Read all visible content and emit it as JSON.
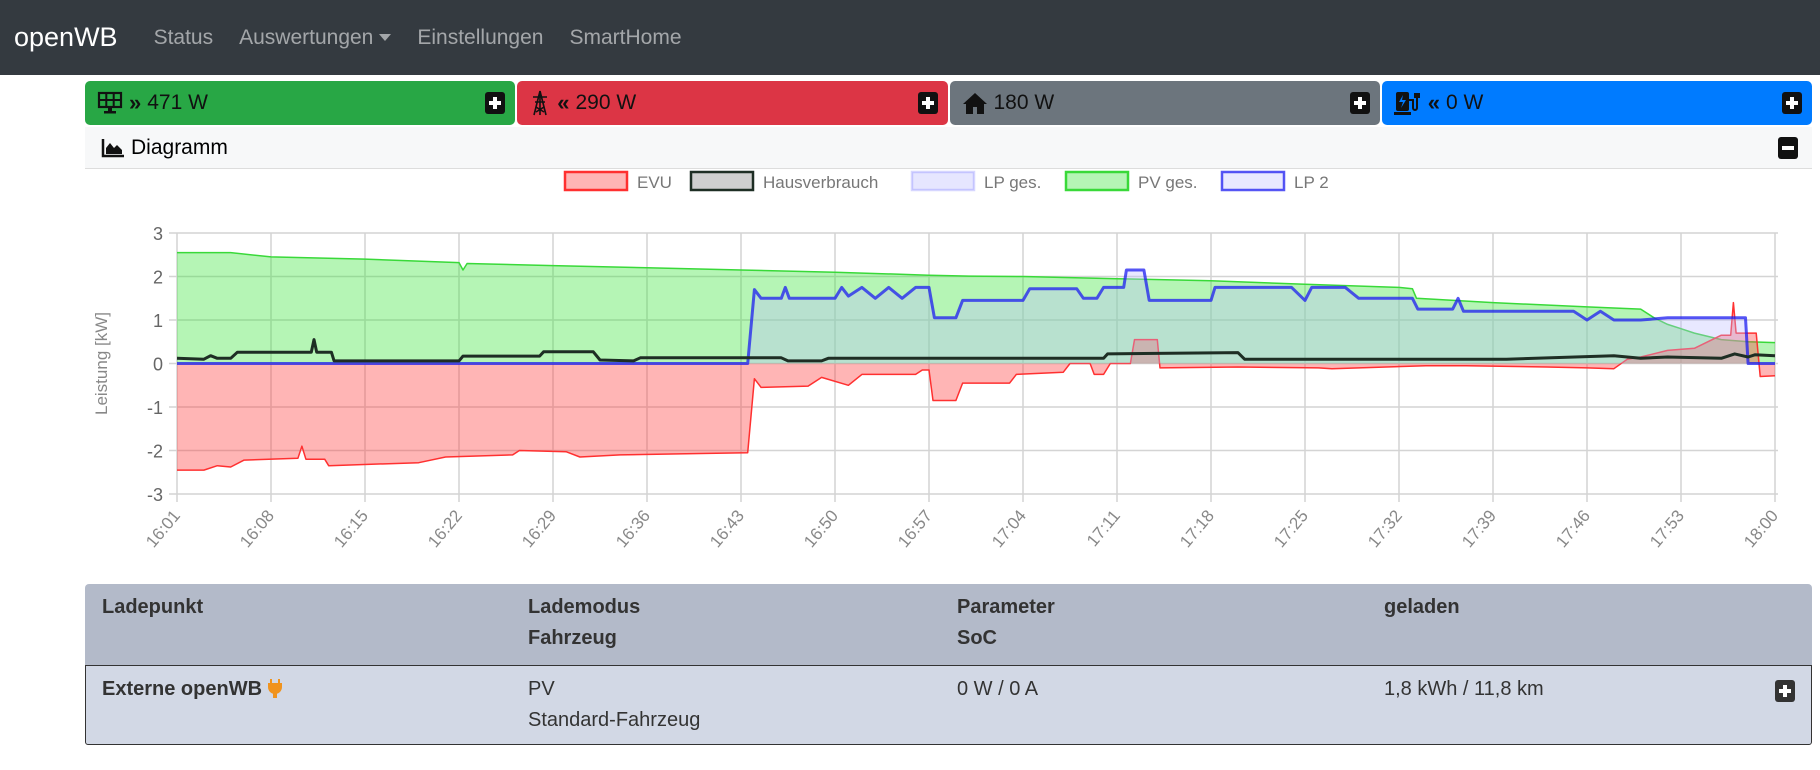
{
  "nav": {
    "brand": "openWB",
    "links": [
      "Status",
      "Auswertungen",
      "Einstellungen",
      "SmartHome"
    ]
  },
  "cards": [
    {
      "icon": "solar-panel-icon",
      "arrow": "»",
      "value": "471 W",
      "color": "#28a745"
    },
    {
      "icon": "power-tower-icon",
      "arrow": "«",
      "value": "290 W",
      "color": "#dc3545"
    },
    {
      "icon": "house-icon",
      "arrow": "",
      "value": "180 W",
      "color": "#6c757d"
    },
    {
      "icon": "charging-station-icon",
      "arrow": "«",
      "value": "0 W",
      "color": "#007bff"
    }
  ],
  "diagram": {
    "title": "Diagramm"
  },
  "chart_data": {
    "type": "line",
    "ylabel": "Leistung [kW]",
    "ylim": [
      -3,
      3
    ],
    "yticks": [
      3,
      2,
      1,
      0,
      -1,
      -2,
      -3
    ],
    "x_unit": "minutes after 16:00",
    "xticks": [
      "16:01",
      "16:08",
      "16:15",
      "16:22",
      "16:29",
      "16:36",
      "16:43",
      "16:50",
      "16:57",
      "17:04",
      "17:11",
      "17:18",
      "17:25",
      "17:32",
      "17:39",
      "17:46",
      "17:53",
      "18:00"
    ],
    "xlim": [
      1,
      120
    ],
    "legend_position": "top",
    "series": [
      {
        "name": "EVU",
        "stroke": "#ff3030",
        "fill": "rgba(255,60,60,0.38)",
        "points": [
          [
            1,
            -2.45
          ],
          [
            3,
            -2.45
          ],
          [
            4,
            -2.35
          ],
          [
            5,
            -2.38
          ],
          [
            6,
            -2.22
          ],
          [
            10,
            -2.18
          ],
          [
            10.3,
            -1.9
          ],
          [
            10.6,
            -2.2
          ],
          [
            12,
            -2.2
          ],
          [
            12.3,
            -2.35
          ],
          [
            19,
            -2.28
          ],
          [
            21,
            -2.15
          ],
          [
            26,
            -2.1
          ],
          [
            26.5,
            -2.0
          ],
          [
            30,
            -2.03
          ],
          [
            31,
            -2.15
          ],
          [
            34,
            -2.1
          ],
          [
            40,
            -2.07
          ],
          [
            43.5,
            -2.05
          ],
          [
            44,
            -0.35
          ],
          [
            44.5,
            -0.55
          ],
          [
            48,
            -0.52
          ],
          [
            49,
            -0.32
          ],
          [
            51,
            -0.5
          ],
          [
            52,
            -0.25
          ],
          [
            56,
            -0.25
          ],
          [
            56.5,
            -0.15
          ],
          [
            57,
            -0.15
          ],
          [
            57.3,
            -0.85
          ],
          [
            59,
            -0.85
          ],
          [
            59.5,
            -0.45
          ],
          [
            63,
            -0.45
          ],
          [
            63.5,
            -0.25
          ],
          [
            67,
            -0.2
          ],
          [
            67.5,
            0.0
          ],
          [
            69,
            0.0
          ],
          [
            69.3,
            -0.25
          ],
          [
            70,
            -0.25
          ],
          [
            70.5,
            0.0
          ],
          [
            72,
            0.0
          ],
          [
            72.3,
            0.55
          ],
          [
            74,
            0.55
          ],
          [
            74.2,
            -0.1
          ],
          [
            80,
            -0.08
          ],
          [
            86,
            -0.1
          ],
          [
            87,
            -0.12
          ],
          [
            94,
            -0.05
          ],
          [
            97,
            -0.05
          ],
          [
            103,
            -0.08
          ],
          [
            106,
            -0.1
          ],
          [
            108,
            -0.12
          ],
          [
            109,
            0.1
          ],
          [
            110,
            0.15
          ],
          [
            112,
            0.3
          ],
          [
            114,
            0.35
          ],
          [
            116,
            0.65
          ],
          [
            116.7,
            0.65
          ],
          [
            116.9,
            1.4
          ],
          [
            117.1,
            0.7
          ],
          [
            118.6,
            0.7
          ],
          [
            118.9,
            -0.3
          ],
          [
            120,
            -0.28
          ]
        ]
      },
      {
        "name": "Hausverbrauch",
        "stroke": "#1e2e24",
        "fill": "rgba(160,160,160,0.5)",
        "points": [
          [
            1,
            0.12
          ],
          [
            3,
            0.1
          ],
          [
            3.5,
            0.18
          ],
          [
            4,
            0.12
          ],
          [
            5,
            0.12
          ],
          [
            5.5,
            0.26
          ],
          [
            11,
            0.26
          ],
          [
            11.2,
            0.55
          ],
          [
            11.4,
            0.26
          ],
          [
            12.5,
            0.26
          ],
          [
            12.7,
            0.06
          ],
          [
            22,
            0.06
          ],
          [
            22.3,
            0.17
          ],
          [
            28,
            0.17
          ],
          [
            28.3,
            0.27
          ],
          [
            32,
            0.27
          ],
          [
            32.5,
            0.08
          ],
          [
            35,
            0.06
          ],
          [
            35.5,
            0.13
          ],
          [
            46,
            0.13
          ],
          [
            46.5,
            0.06
          ],
          [
            49,
            0.06
          ],
          [
            49.5,
            0.12
          ],
          [
            70,
            0.12
          ],
          [
            70.3,
            0.22
          ],
          [
            80,
            0.25
          ],
          [
            80.5,
            0.1
          ],
          [
            100,
            0.1
          ],
          [
            108,
            0.18
          ],
          [
            110,
            0.12
          ],
          [
            112,
            0.15
          ],
          [
            116,
            0.12
          ],
          [
            117,
            0.22
          ],
          [
            118,
            0.15
          ],
          [
            118.5,
            0.2
          ],
          [
            120,
            0.18
          ]
        ]
      },
      {
        "name": "LP ges.",
        "stroke": "rgba(120,120,255,0.3)",
        "fill": "rgba(200,200,255,0.45)",
        "points": []
      },
      {
        "name": "PV ges.",
        "stroke": "#39d939",
        "fill": "rgba(60,230,60,0.38)",
        "points": [
          [
            1,
            2.55
          ],
          [
            5,
            2.55
          ],
          [
            8,
            2.45
          ],
          [
            15,
            2.4
          ],
          [
            22,
            2.32
          ],
          [
            22.3,
            2.15
          ],
          [
            22.6,
            2.3
          ],
          [
            29,
            2.25
          ],
          [
            36,
            2.2
          ],
          [
            43,
            2.15
          ],
          [
            50,
            2.1
          ],
          [
            57,
            2.03
          ],
          [
            60,
            2.01
          ],
          [
            64,
            2.0
          ],
          [
            71,
            1.95
          ],
          [
            78,
            1.9
          ],
          [
            85,
            1.82
          ],
          [
            92,
            1.75
          ],
          [
            93,
            1.72
          ],
          [
            93.3,
            1.5
          ],
          [
            99,
            1.4
          ],
          [
            106,
            1.3
          ],
          [
            110,
            1.25
          ],
          [
            111,
            1.05
          ],
          [
            112,
            0.9
          ],
          [
            113,
            0.8
          ],
          [
            114,
            0.7
          ],
          [
            116,
            0.55
          ],
          [
            118,
            0.5
          ],
          [
            120,
            0.48
          ]
        ]
      },
      {
        "name": "LP 2",
        "stroke": "rgba(30,30,240,0.75)",
        "fill": "rgba(190,190,255,0.35)",
        "points": [
          [
            1,
            0
          ],
          [
            43.5,
            0
          ],
          [
            44,
            1.7
          ],
          [
            44.5,
            1.5
          ],
          [
            46,
            1.5
          ],
          [
            46.3,
            1.75
          ],
          [
            46.6,
            1.5
          ],
          [
            50,
            1.5
          ],
          [
            50.5,
            1.75
          ],
          [
            51,
            1.55
          ],
          [
            52,
            1.75
          ],
          [
            53,
            1.5
          ],
          [
            54,
            1.75
          ],
          [
            55,
            1.5
          ],
          [
            56,
            1.75
          ],
          [
            57,
            1.75
          ],
          [
            57.4,
            1.05
          ],
          [
            59,
            1.05
          ],
          [
            59.5,
            1.45
          ],
          [
            64,
            1.45
          ],
          [
            64.5,
            1.72
          ],
          [
            68,
            1.72
          ],
          [
            68.5,
            1.5
          ],
          [
            69.5,
            1.5
          ],
          [
            70,
            1.75
          ],
          [
            71.5,
            1.75
          ],
          [
            71.7,
            2.15
          ],
          [
            73,
            2.15
          ],
          [
            73.4,
            1.45
          ],
          [
            78,
            1.45
          ],
          [
            78.3,
            1.75
          ],
          [
            84,
            1.75
          ],
          [
            85,
            1.45
          ],
          [
            85.5,
            1.75
          ],
          [
            88,
            1.75
          ],
          [
            89,
            1.5
          ],
          [
            93,
            1.5
          ],
          [
            93.4,
            1.25
          ],
          [
            96,
            1.25
          ],
          [
            96.4,
            1.5
          ],
          [
            96.8,
            1.2
          ],
          [
            105,
            1.2
          ],
          [
            106,
            1.0
          ],
          [
            107,
            1.2
          ],
          [
            108,
            1.0
          ],
          [
            110,
            1.0
          ],
          [
            112,
            1.05
          ],
          [
            116,
            1.05
          ],
          [
            117.8,
            1.05
          ],
          [
            118,
            0.0
          ],
          [
            120,
            0.0
          ]
        ]
      }
    ]
  },
  "table": {
    "headers": [
      [
        "Ladepunkt"
      ],
      [
        "Lademodus",
        "Fahrzeug"
      ],
      [
        "Parameter",
        "SoC"
      ],
      [
        "geladen"
      ]
    ],
    "row": {
      "name": "Externe openWB",
      "mode": "PV",
      "vehicle": "Standard-Fahrzeug",
      "parameter": "0 W / 0 A",
      "charged": "1,8 kWh / 11,8 km"
    }
  }
}
